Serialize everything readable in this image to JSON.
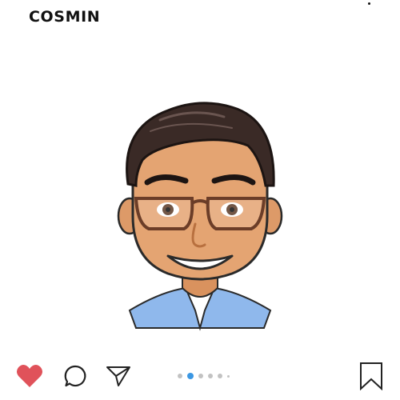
{
  "post": {
    "username": "COSMIN",
    "liked": true
  },
  "colors": {
    "like": "#e0525a",
    "pager_active": "#3b97e3",
    "pager_inactive": "#c2c2c2",
    "icon_stroke": "#222222"
  },
  "icons": {
    "more": "more-options-icon",
    "like": "heart-icon",
    "comment": "comment-icon",
    "share": "send-icon",
    "save": "bookmark-icon"
  },
  "carousel": {
    "total_dots": 6,
    "active_index": 1
  }
}
